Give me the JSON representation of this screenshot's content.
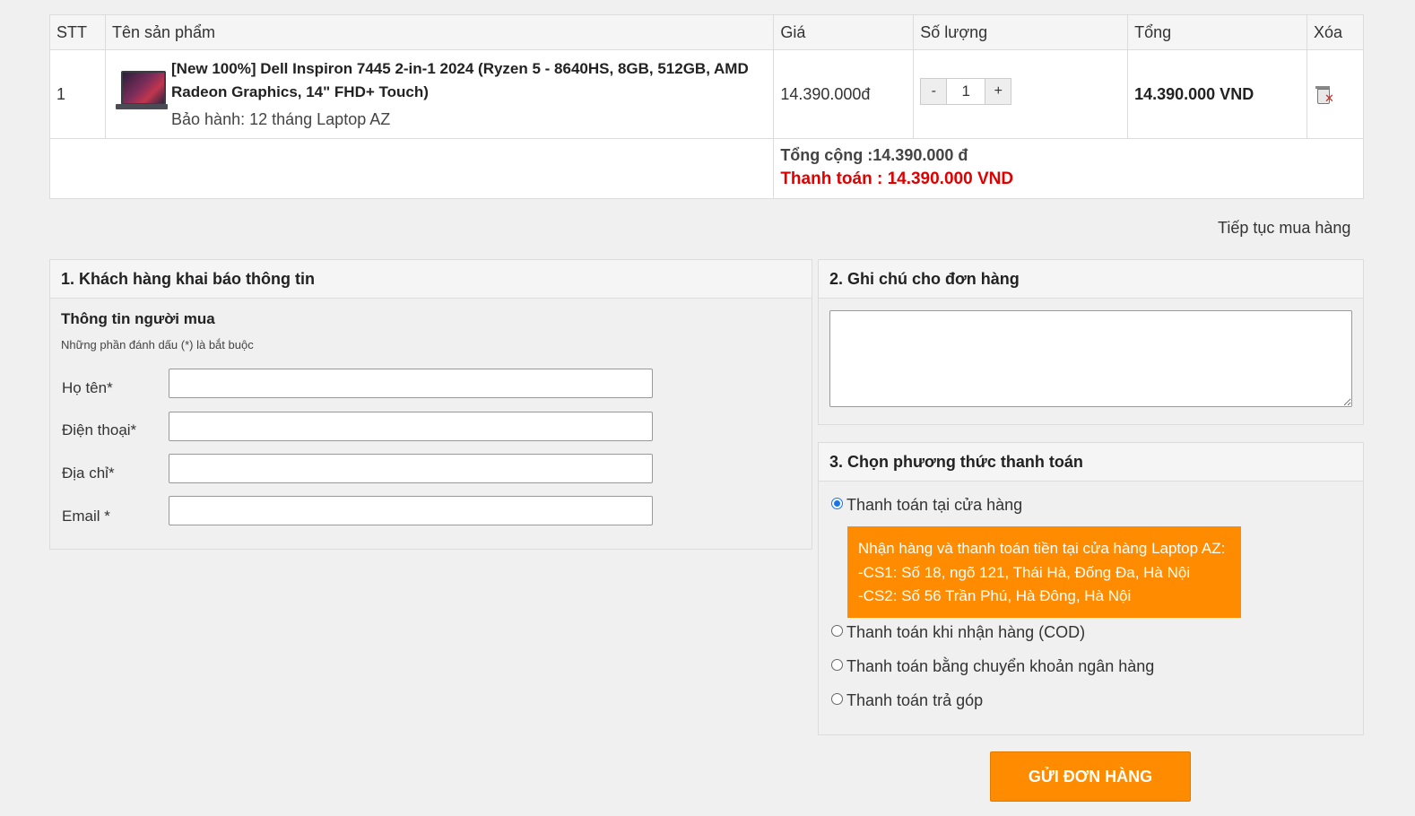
{
  "cart": {
    "headers": {
      "stt": "STT",
      "name": "Tên sản phẩm",
      "price": "Giá",
      "qty": "Số lượng",
      "total": "Tổng",
      "delete": "Xóa"
    },
    "items": [
      {
        "stt": "1",
        "name": "[New 100%] Dell Inspiron 7445 2-in-1 2024 (Ryzen 5 - 8640HS, 8GB, 512GB, AMD Radeon Graphics, 14\" FHD+ Touch)",
        "warranty": "Bảo hành: 12 tháng Laptop AZ",
        "price": "14.390.000đ",
        "qty_minus": "-",
        "qty": "1",
        "qty_plus": "+",
        "line_total": "14.390.000 VND",
        "delete_icon": "trash-icon"
      }
    ],
    "sum_text": "Tổng cộng :14.390.000 đ",
    "pay_text": "Thanh toán : 14.390.000 VND"
  },
  "continue_link": "Tiếp tục mua hàng",
  "customer": {
    "heading": "1. Khách hàng khai báo thông tin",
    "title": "Thông tin người mua",
    "note": "Những phần đánh dấu (*) là bắt buộc",
    "fields": [
      {
        "label": "Họ tên*",
        "value": ""
      },
      {
        "label": "Điện thoại*",
        "value": ""
      },
      {
        "label": "Địa chỉ*",
        "value": ""
      },
      {
        "label": "Email *",
        "value": ""
      }
    ]
  },
  "order_note": {
    "heading": "2. Ghi chú cho đơn hàng",
    "value": ""
  },
  "payment": {
    "heading": "3. Chọn phương thức thanh toán",
    "options": [
      {
        "label": "Thanh toán tại cửa hàng",
        "checked": true
      },
      {
        "label": "Thanh toán khi nhận hàng (COD)",
        "checked": false
      },
      {
        "label": "Thanh toán bằng chuyển khoản ngân hàng",
        "checked": false
      },
      {
        "label": "Thanh toán trả góp",
        "checked": false
      }
    ],
    "store_info": [
      "Nhận hàng và thanh toán tiền tại cửa hàng Laptop AZ:",
      "-CS1: Số 18, ngõ 121, Thái Hà, Đống Đa, Hà Nội",
      "-CS2: Số 56 Trần Phú, Hà Đông, Hà Nội"
    ]
  },
  "submit_label": "GỬI ĐƠN HÀNG",
  "colors": {
    "accent": "#ff8c00",
    "price_red": "#e00000",
    "radio_blue": "#1a73e8"
  }
}
